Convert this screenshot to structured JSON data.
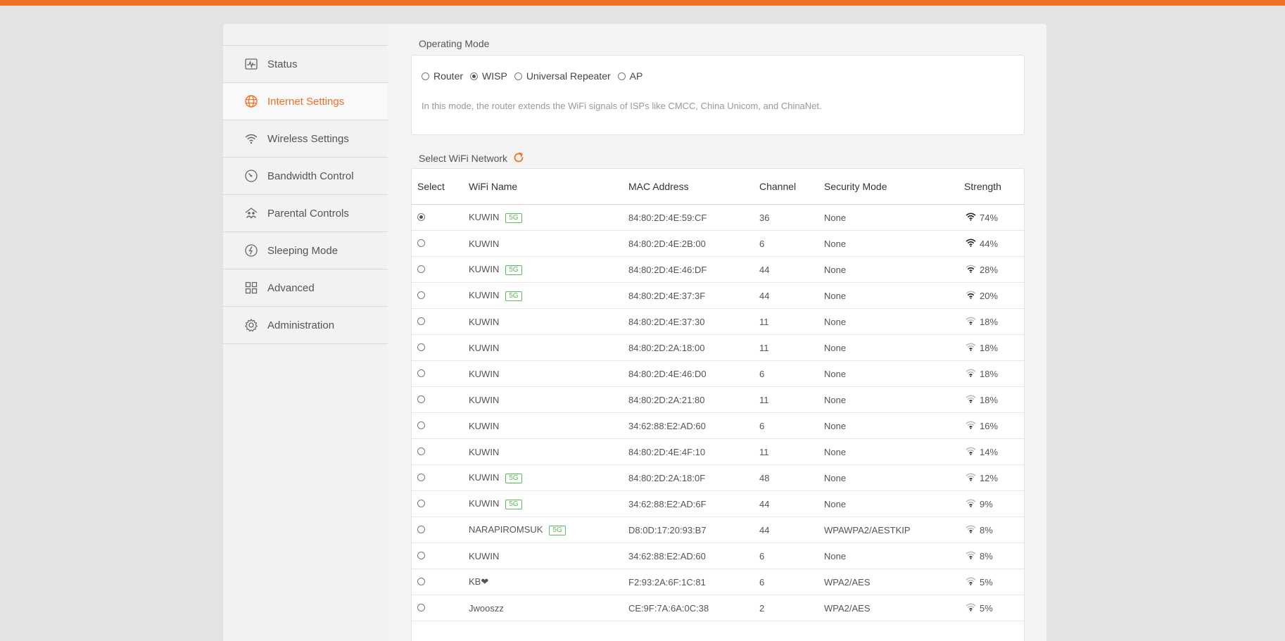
{
  "sidebar": {
    "items": [
      {
        "label": "Status",
        "icon": "status-icon",
        "active": false
      },
      {
        "label": "Internet Settings",
        "icon": "globe-icon",
        "active": true
      },
      {
        "label": "Wireless Settings",
        "icon": "wifi-icon",
        "active": false
      },
      {
        "label": "Bandwidth Control",
        "icon": "gauge-icon",
        "active": false
      },
      {
        "label": "Parental Controls",
        "icon": "family-icon",
        "active": false
      },
      {
        "label": "Sleeping Mode",
        "icon": "sleep-icon",
        "active": false
      },
      {
        "label": "Advanced",
        "icon": "grid-icon",
        "active": false
      },
      {
        "label": "Administration",
        "icon": "gear-icon",
        "active": false
      }
    ]
  },
  "operating_mode": {
    "title": "Operating Mode",
    "options": [
      "Router",
      "WISP",
      "Universal Repeater",
      "AP"
    ],
    "selected": "WISP",
    "description": "In this mode, the router extends the WiFi signals of ISPs like CMCC, China Unicom, and ChinaNet."
  },
  "wifi_select": {
    "title": "Select WiFi Network",
    "columns": [
      "Select",
      "WiFi Name",
      "MAC Address",
      "Channel",
      "Security Mode",
      "Strength"
    ],
    "rows": [
      {
        "name": "KUWIN",
        "band": "5G",
        "mac": "84:80:2D:4E:59:CF",
        "channel": "36",
        "security": "None",
        "strength": "74%",
        "selected": true
      },
      {
        "name": "KUWIN",
        "band": "",
        "mac": "84:80:2D:4E:2B:00",
        "channel": "6",
        "security": "None",
        "strength": "44%",
        "selected": false
      },
      {
        "name": "KUWIN",
        "band": "5G",
        "mac": "84:80:2D:4E:46:DF",
        "channel": "44",
        "security": "None",
        "strength": "28%",
        "selected": false
      },
      {
        "name": "KUWIN",
        "band": "5G",
        "mac": "84:80:2D:4E:37:3F",
        "channel": "44",
        "security": "None",
        "strength": "20%",
        "selected": false
      },
      {
        "name": "KUWIN",
        "band": "",
        "mac": "84:80:2D:4E:37:30",
        "channel": "11",
        "security": "None",
        "strength": "18%",
        "selected": false
      },
      {
        "name": "KUWIN",
        "band": "",
        "mac": "84:80:2D:2A:18:00",
        "channel": "11",
        "security": "None",
        "strength": "18%",
        "selected": false
      },
      {
        "name": "KUWIN",
        "band": "",
        "mac": "84:80:2D:4E:46:D0",
        "channel": "6",
        "security": "None",
        "strength": "18%",
        "selected": false
      },
      {
        "name": "KUWIN",
        "band": "",
        "mac": "84:80:2D:2A:21:80",
        "channel": "11",
        "security": "None",
        "strength": "18%",
        "selected": false
      },
      {
        "name": "KUWIN",
        "band": "",
        "mac": "34:62:88:E2:AD:60",
        "channel": "6",
        "security": "None",
        "strength": "16%",
        "selected": false
      },
      {
        "name": "KUWIN",
        "band": "",
        "mac": "84:80:2D:4E:4F:10",
        "channel": "11",
        "security": "None",
        "strength": "14%",
        "selected": false
      },
      {
        "name": "KUWIN",
        "band": "5G",
        "mac": "84:80:2D:2A:18:0F",
        "channel": "48",
        "security": "None",
        "strength": "12%",
        "selected": false
      },
      {
        "name": "KUWIN",
        "band": "5G",
        "mac": "34:62:88:E2:AD:6F",
        "channel": "44",
        "security": "None",
        "strength": "9%",
        "selected": false
      },
      {
        "name": "NARAPIROMSUK",
        "band": "5G",
        "mac": "D8:0D:17:20:93:B7",
        "channel": "44",
        "security": "WPAWPA2/AESTKIP",
        "strength": "8%",
        "selected": false
      },
      {
        "name": "KUWIN",
        "band": "",
        "mac": "34:62:88:E2:AD:60",
        "channel": "6",
        "security": "None",
        "strength": "8%",
        "selected": false
      },
      {
        "name": "KB❤",
        "band": "",
        "mac": "F2:93:2A:6F:1C:81",
        "channel": "6",
        "security": "WPA2/AES",
        "strength": "5%",
        "selected": false
      },
      {
        "name": "Jwooszz",
        "band": "",
        "mac": "CE:9F:7A:6A:0C:38",
        "channel": "2",
        "security": "WPA2/AES",
        "strength": "5%",
        "selected": false
      }
    ]
  },
  "colors": {
    "accent": "#f07025",
    "tag_5g": "#5cb85c"
  }
}
